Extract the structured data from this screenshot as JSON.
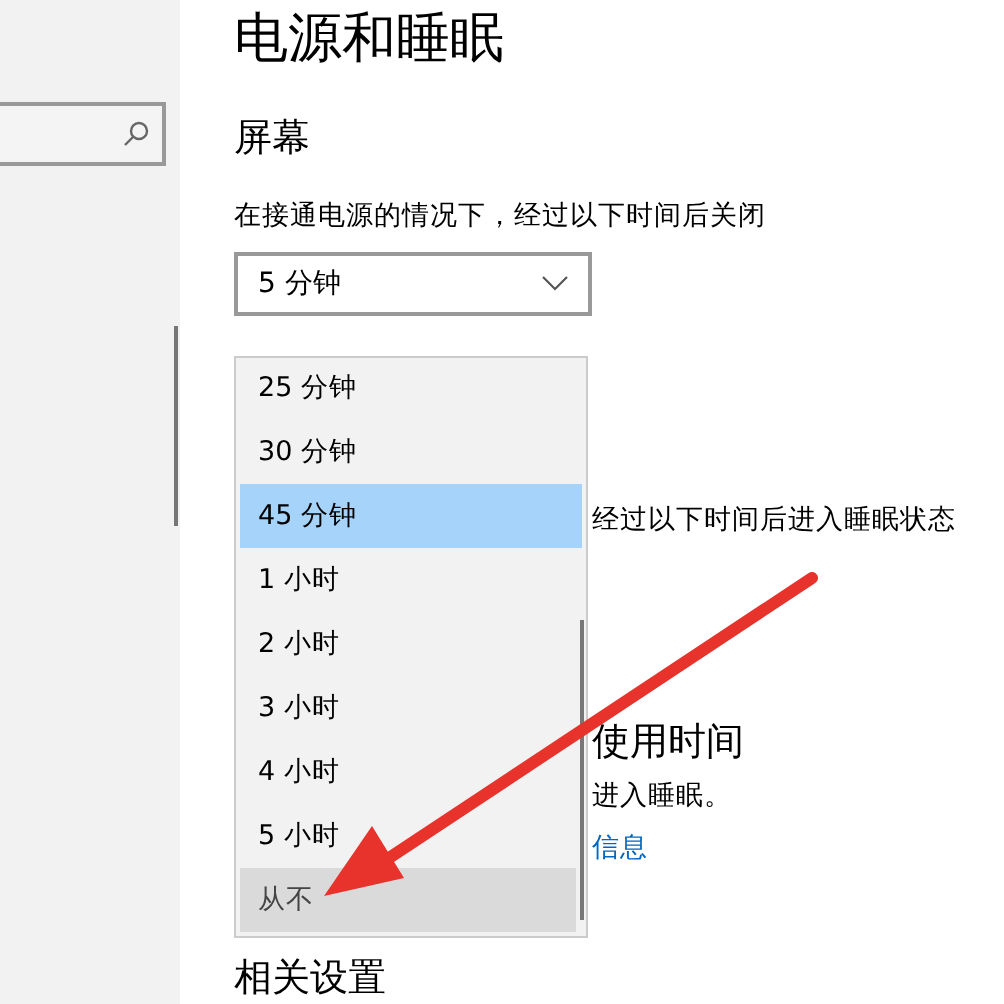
{
  "page": {
    "title": "电源和睡眠",
    "section": "屏幕",
    "screen_label": "在接通电源的情况下，经过以下时间后关闭",
    "screen_value": "5 分钟"
  },
  "dropdown_options": [
    {
      "label": "25 分钟",
      "selected": false,
      "hovered": false
    },
    {
      "label": "30 分钟",
      "selected": false,
      "hovered": false
    },
    {
      "label": "45 分钟",
      "selected": true,
      "hovered": false
    },
    {
      "label": "1 小时",
      "selected": false,
      "hovered": false
    },
    {
      "label": "2 小时",
      "selected": false,
      "hovered": false
    },
    {
      "label": "3 小时",
      "selected": false,
      "hovered": false
    },
    {
      "label": "4 小时",
      "selected": false,
      "hovered": false
    },
    {
      "label": "5 小时",
      "selected": false,
      "hovered": false
    },
    {
      "label": "从不",
      "selected": false,
      "hovered": true
    }
  ],
  "partly_hidden": {
    "sleep_label": "经过以下时间后进入睡眠状态",
    "heading": "使用时间",
    "note": "进入睡眠。",
    "link": "信息"
  },
  "related_heading": "相关设置"
}
